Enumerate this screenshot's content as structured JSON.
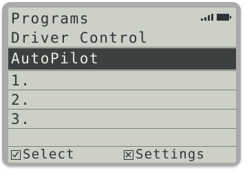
{
  "header": {
    "title": "Programs",
    "subtitle": "Driver Control",
    "status_icons": [
      "signal-strength-icon",
      "battery-icon"
    ]
  },
  "menu": {
    "items": [
      {
        "label": "AutoPilot",
        "selected": true
      },
      {
        "label": "1.",
        "selected": false
      },
      {
        "label": "2.",
        "selected": false
      },
      {
        "label": "3.",
        "selected": false
      }
    ]
  },
  "footer": {
    "select_label": "Select",
    "select_icon": "check-box-icon",
    "settings_label": "Settings",
    "settings_icon": "x-box-icon"
  },
  "colors": {
    "screen_bg": "#ccd0c7",
    "text": "#2e3334",
    "highlight_bg": "#3c4140",
    "highlight_text": "#e8ebe3",
    "bezel": "#a9aaa9"
  }
}
